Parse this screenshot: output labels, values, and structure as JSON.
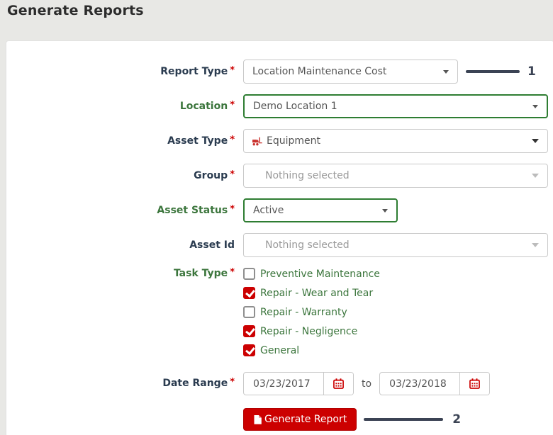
{
  "page": {
    "title": "Generate Reports"
  },
  "form": {
    "required_marker": "*",
    "report_type": {
      "label": "Report Type",
      "value": "Location Maintenance Cost"
    },
    "location": {
      "label": "Location",
      "value": "Demo Location 1"
    },
    "asset_type": {
      "label": "Asset Type",
      "value": "Equipment",
      "icon": "equipment-icon"
    },
    "group": {
      "label": "Group",
      "placeholder": "Nothing selected"
    },
    "asset_status": {
      "label": "Asset Status",
      "value": "Active"
    },
    "asset_id": {
      "label": "Asset Id",
      "placeholder": "Nothing selected"
    },
    "task_type": {
      "label": "Task Type",
      "options": [
        {
          "label": "Preventive Maintenance",
          "checked": false
        },
        {
          "label": "Repair - Wear and Tear",
          "checked": true
        },
        {
          "label": "Repair - Warranty",
          "checked": false
        },
        {
          "label": "Repair - Negligence",
          "checked": true
        },
        {
          "label": "General",
          "checked": true
        }
      ]
    },
    "date_range": {
      "label": "Date Range",
      "start_date": "03/23/2017",
      "separator": "to",
      "end_date": "03/23/2018"
    },
    "submit_label": "Generate Report"
  },
  "annotations": {
    "step1": "1",
    "step2": "2"
  },
  "colors": {
    "accent_red": "#cc0000",
    "success_green": "#3c763d",
    "success_border": "#2e7d32",
    "label_navy": "#2b3c50",
    "annotation_dark": "#3b4354"
  }
}
